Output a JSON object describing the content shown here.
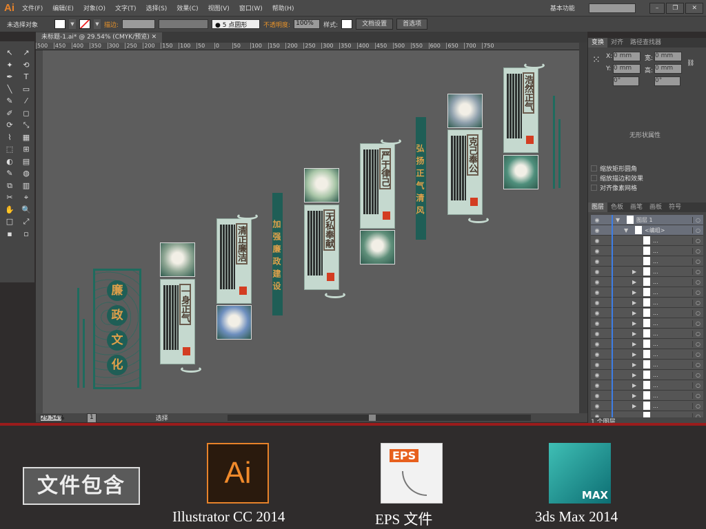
{
  "app": {
    "logo": "Ai",
    "menus": [
      "文件(F)",
      "编辑(E)",
      "对象(O)",
      "文字(T)",
      "选择(S)",
      "效果(C)",
      "视图(V)",
      "窗口(W)",
      "帮助(H)"
    ],
    "workspace": "基本功能",
    "search_placeholder": ""
  },
  "control": {
    "selection": "未选择对象",
    "stroke_label": "描边:",
    "brush": "5 点圆形",
    "opacity_label": "不透明度:",
    "opacity": "100%",
    "style_label": "样式:",
    "doc_setup": "文档设置",
    "preferences": "首选项"
  },
  "document": {
    "tab": "未标题-1.ai* @ 29.54% (CMYK/预览)",
    "ruler": [
      "500",
      "450",
      "400",
      "350",
      "300",
      "250",
      "200",
      "150",
      "100",
      "50",
      "0",
      "50",
      "100",
      "150",
      "200",
      "250",
      "300",
      "350",
      "400",
      "450",
      "500",
      "550",
      "600",
      "650",
      "700",
      "750"
    ]
  },
  "status": {
    "zoom": "29.54%",
    "page": "1",
    "tool": "选择"
  },
  "artwork": {
    "main_title": [
      "廉",
      "政",
      "文",
      "化"
    ],
    "panels": [
      {
        "title": "一身正气"
      },
      {
        "title": "清正廉洁"
      },
      {
        "title": "无私奉献"
      },
      {
        "title": "严于律己"
      },
      {
        "title": "克己奉公"
      },
      {
        "title": "浩然正气"
      }
    ],
    "banners": [
      "加强廉政建设",
      "弘扬正气清风"
    ],
    "colors": {
      "panel": "#c5d9cf",
      "banner": "#1f5e56",
      "gold": "#e0a04a"
    }
  },
  "transform": {
    "tabs": [
      "变换",
      "对齐",
      "路径查找器"
    ],
    "x": "0 mm",
    "y": "0 mm",
    "w": "0 mm",
    "h": "0 mm",
    "x_label": "X:",
    "y_label": "Y:",
    "w_label": "宽:",
    "h_label": "高:",
    "angle1": "0°",
    "angle2": "0°",
    "empty": "无形状属性",
    "checks": [
      "缩放矩形圆角",
      "缩放描边和效果",
      "对齐像素网格"
    ]
  },
  "layers": {
    "tabs": [
      "图层",
      "色板",
      "画笔",
      "画板",
      "符号"
    ],
    "layer_name": "图层 1",
    "group_name": "<编组>",
    "item_label": "...",
    "rows": 20,
    "expandable": [
      5,
      6,
      7,
      8,
      9,
      10,
      11,
      12,
      13,
      14,
      15,
      16,
      17,
      18
    ],
    "footer": "1 个图层"
  },
  "bottom": {
    "box": "文件包含",
    "ai_icon": "Ai",
    "eps_icon": "EPS",
    "max_icon": "MAX",
    "labels": [
      "Illustrator CC 2014",
      "EPS 文件",
      "3ds Max 2014"
    ]
  }
}
